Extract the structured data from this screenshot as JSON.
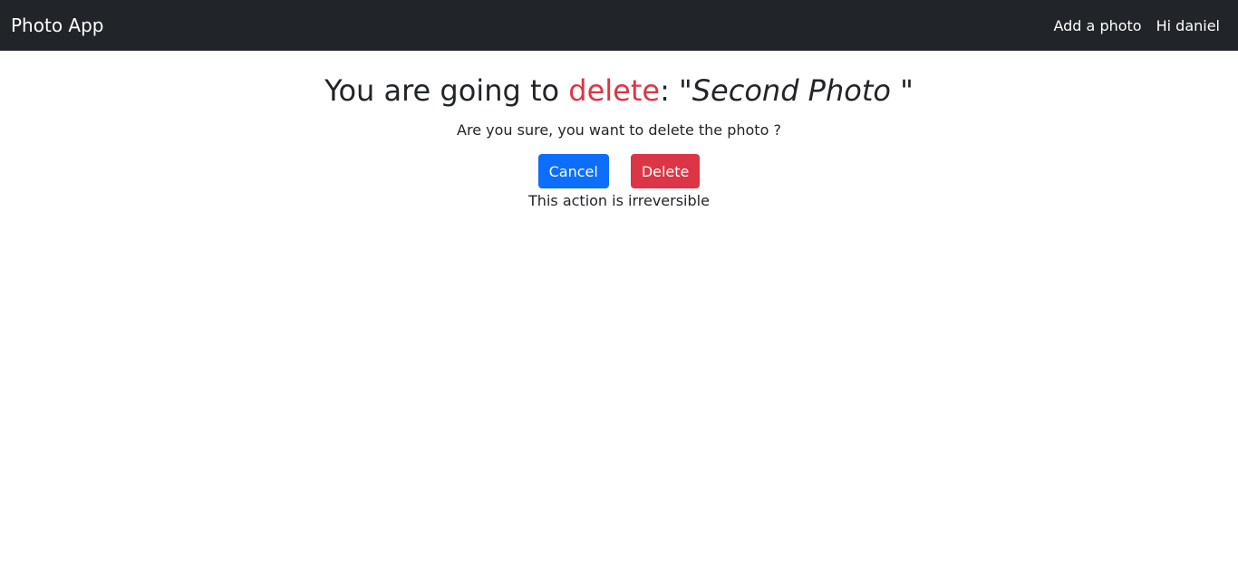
{
  "navbar": {
    "brand": "Photo App",
    "links": [
      {
        "label": "Add a photo"
      },
      {
        "label": "Hi daniel"
      }
    ]
  },
  "dialog": {
    "heading_prefix": "You are going to ",
    "heading_action": "delete",
    "heading_colon": ": \"",
    "photo_title": "Second Photo",
    "heading_suffix": " \"",
    "question": "Are you sure, you want to delete the photo ?",
    "cancel_label": "Cancel",
    "delete_label": "Delete",
    "note": "This action is irreversible"
  },
  "colors": {
    "navbar_bg": "#212529",
    "primary": "#0d6efd",
    "danger": "#dc3545"
  }
}
